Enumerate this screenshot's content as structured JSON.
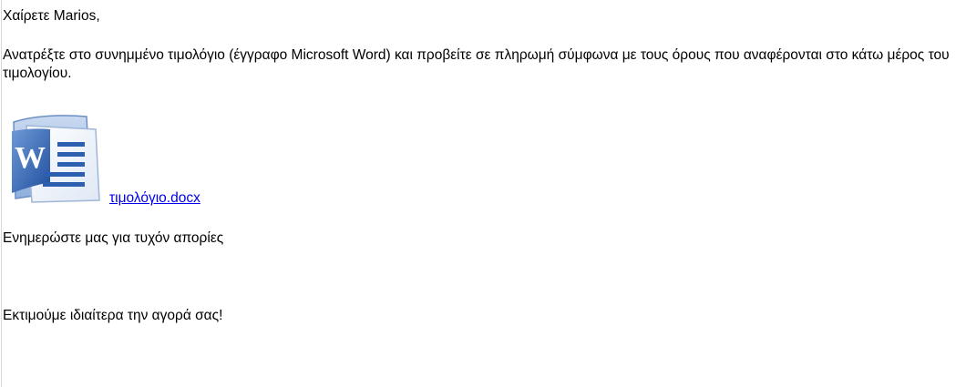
{
  "email": {
    "greeting": "Χαίρετε Marios,",
    "instructions": "Ανατρέξτε στο συνημμένο τιμολόγιο (έγγραφο Microsoft Word) και προβείτε σε πληρωμή σύμφωνα με τους όρους που αναφέρονται στο κάτω μέρος του τιμολογίου.",
    "attachment": {
      "icon": "word-document-icon",
      "filename": "τιμολόγιο.docx",
      "link_color": "#0000ee"
    },
    "info_line": "Ενημερώστε μας για τυχόν απορίες",
    "thanks_line": "Εκτιμούμε ιδιαίτερα την αγορά σας!"
  }
}
